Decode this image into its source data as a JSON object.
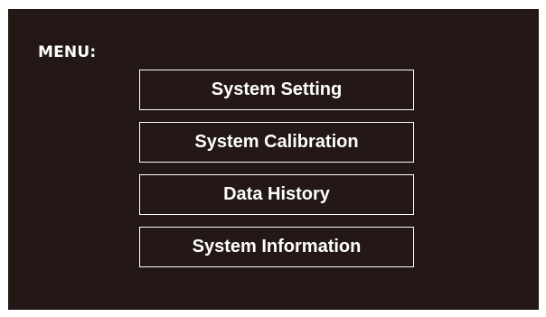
{
  "menu": {
    "title": "MENU:",
    "items": [
      {
        "label": "System Setting"
      },
      {
        "label": "System Calibration"
      },
      {
        "label": "Data History"
      },
      {
        "label": "System Information"
      }
    ]
  },
  "colors": {
    "background": "#231815",
    "foreground": "#ffffff"
  }
}
